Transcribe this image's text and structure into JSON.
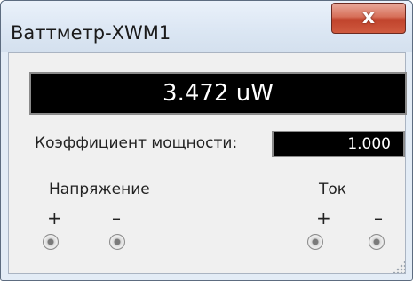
{
  "window": {
    "title": "Ваттметр-XWM1",
    "close_label": "x"
  },
  "meter": {
    "power_reading": "3.472 uW",
    "power_factor_label": "Коэффициент мощности:",
    "power_factor_value": "1.000"
  },
  "terminals": {
    "voltage_label": "Напряжение",
    "current_label": "Ток",
    "plus_sign": "+",
    "minus_sign": "–"
  },
  "icons": {
    "close": "close-icon",
    "terminal": "terminal-icon",
    "resize_grip": "resize-grip-icon"
  },
  "colors": {
    "titlebar": "#dbe6f3",
    "close_button": "#c74a32",
    "display_bg": "#000000",
    "display_text": "#ffffff"
  }
}
